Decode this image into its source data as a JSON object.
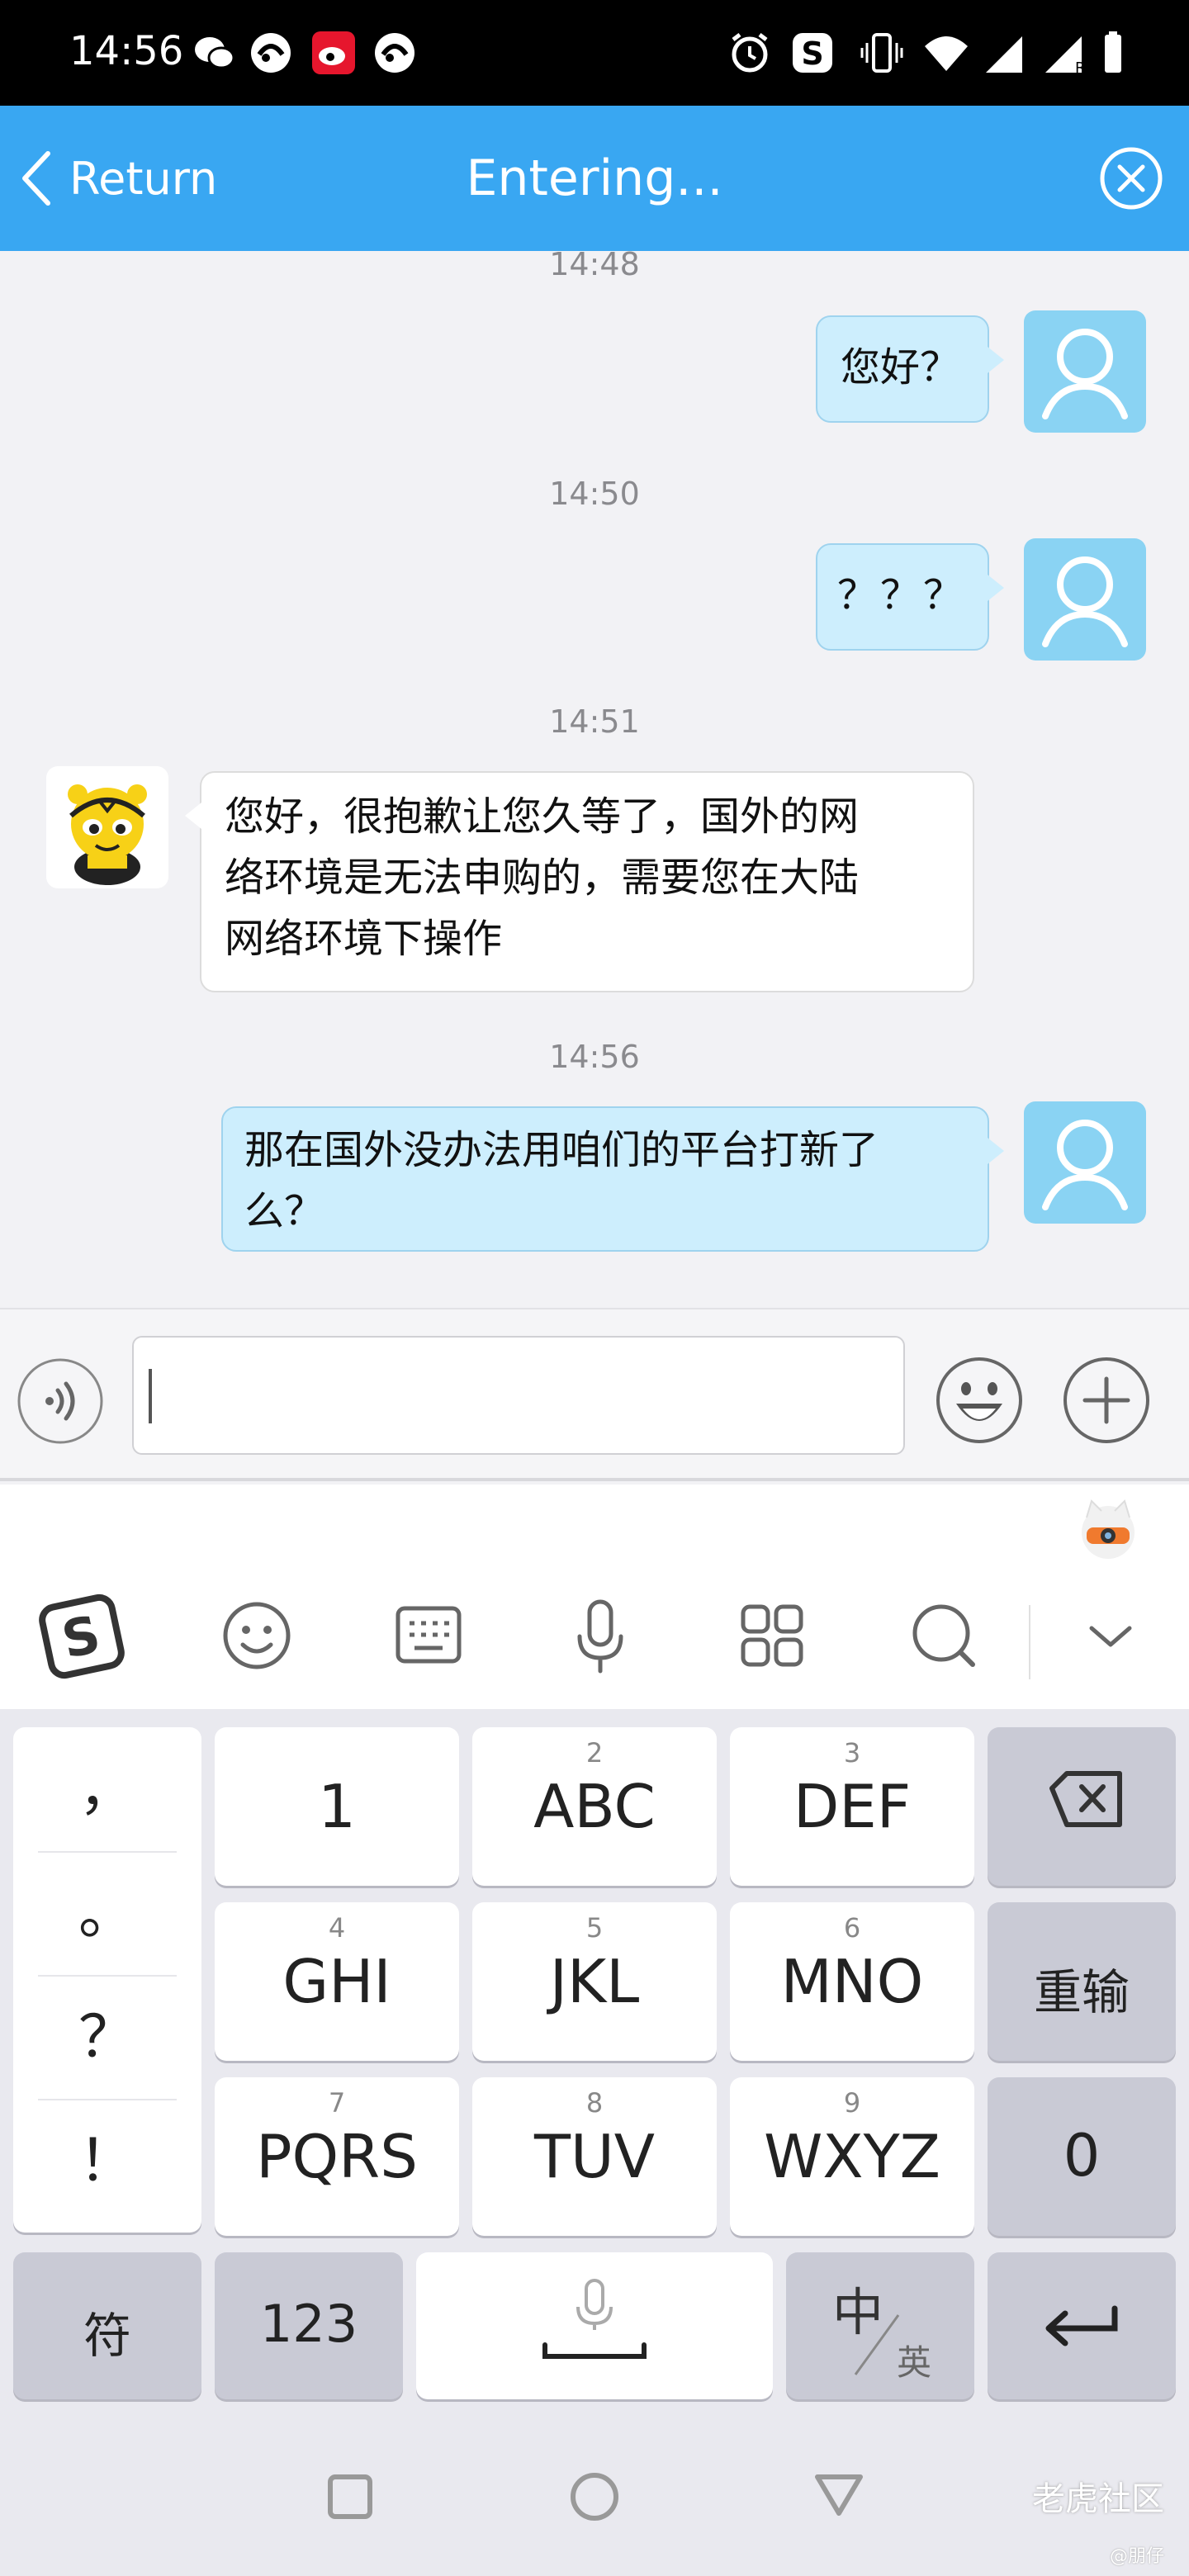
{
  "status_bar": {
    "time": "14:56"
  },
  "header": {
    "back_label": "Return",
    "title": "Entering..."
  },
  "messages": [
    {
      "timestamp": "14:48",
      "sender": "user",
      "text": "您好？"
    },
    {
      "timestamp": "14:50",
      "sender": "user",
      "text": "？？？"
    },
    {
      "timestamp": "14:51",
      "sender": "agent",
      "lines": [
        "您好，很抱歉让您久等了，国外的网",
        "络环境是无法申购的，需要您在大陆",
        "网络环境下操作"
      ]
    },
    {
      "timestamp": "14:56",
      "sender": "user",
      "lines": [
        "那在国外没办法用咱们的平台打新了",
        "么？"
      ]
    }
  ],
  "input": {
    "value": ""
  },
  "keyboard": {
    "punctuation": [
      "，",
      "。",
      "？",
      "！"
    ],
    "rows": [
      [
        {
          "sub": "",
          "main": "1"
        },
        {
          "sub": "2",
          "main": "ABC"
        },
        {
          "sub": "3",
          "main": "DEF"
        }
      ],
      [
        {
          "sub": "4",
          "main": "GHI"
        },
        {
          "sub": "5",
          "main": "JKL"
        },
        {
          "sub": "6",
          "main": "MNO"
        }
      ],
      [
        {
          "sub": "7",
          "main": "PQRS"
        },
        {
          "sub": "8",
          "main": "TUV"
        },
        {
          "sub": "9",
          "main": "WXYZ"
        }
      ]
    ],
    "reinput_label": "重输",
    "zero_label": "0",
    "symbol_label": "符",
    "num_label": "123",
    "lang_main": "中",
    "lang_sub": "英"
  },
  "watermark": {
    "text": "老虎社区",
    "sub": "@朋仔"
  },
  "colors": {
    "header": "#39a7f2",
    "user_bubble": "#cdeefd",
    "avatar": "#8ad3f3"
  }
}
